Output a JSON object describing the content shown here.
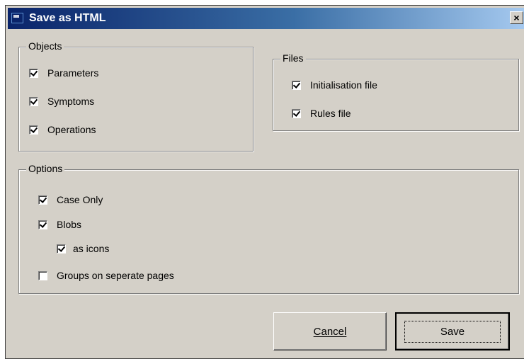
{
  "window": {
    "title": "Save as HTML",
    "close_glyph": "×"
  },
  "objects": {
    "legend": "Objects",
    "items": [
      {
        "label": "Parameters",
        "checked": true
      },
      {
        "label": "Symptoms",
        "checked": true
      },
      {
        "label": "Operations",
        "checked": true
      }
    ]
  },
  "files": {
    "legend": "Files",
    "items": [
      {
        "label": "Initialisation file",
        "checked": true
      },
      {
        "label": "Rules file",
        "checked": true
      }
    ]
  },
  "options": {
    "legend": "Options",
    "items": [
      {
        "label": "Case Only",
        "checked": true
      },
      {
        "label": "Blobs",
        "checked": true
      },
      {
        "label": "as icons",
        "checked": true
      },
      {
        "label": "Groups on seperate pages",
        "checked": false
      }
    ]
  },
  "buttons": {
    "cancel": "Cancel",
    "save": "Save"
  }
}
